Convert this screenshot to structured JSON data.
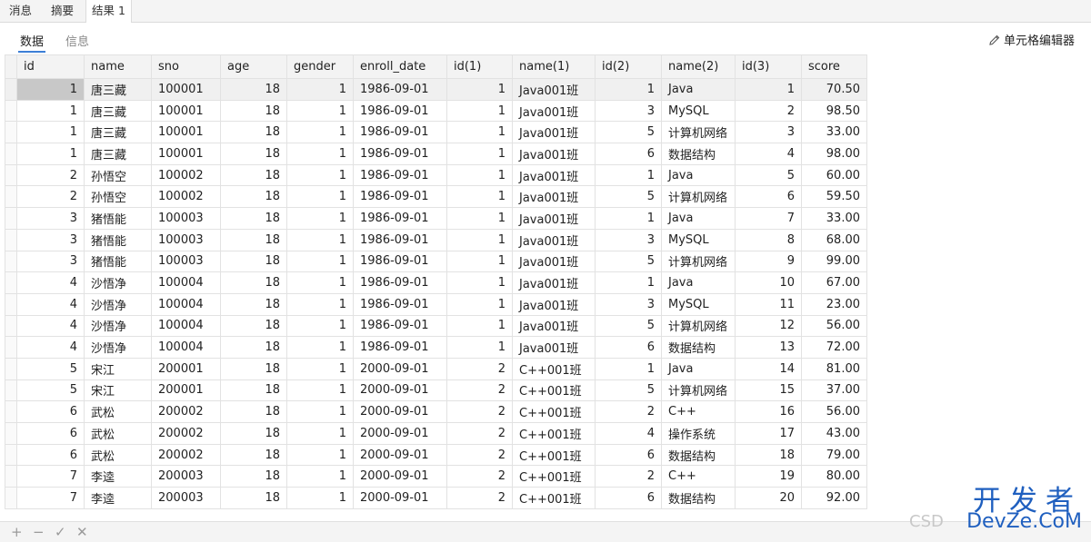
{
  "tabs": [
    "消息",
    "摘要",
    "结果 1"
  ],
  "subtabs": [
    "数据",
    "信息"
  ],
  "cell_editor_label": "单元格编辑器",
  "columns": [
    "id",
    "name",
    "sno",
    "age",
    "gender",
    "enroll_date",
    "id(1)",
    "name(1)",
    "id(2)",
    "name(2)",
    "id(3)",
    "score"
  ],
  "rows": [
    [
      "1",
      "唐三藏",
      "100001",
      "18",
      "1",
      "1986-09-01",
      "1",
      "Java001班",
      "1",
      "Java",
      "1",
      "70.50"
    ],
    [
      "1",
      "唐三藏",
      "100001",
      "18",
      "1",
      "1986-09-01",
      "1",
      "Java001班",
      "3",
      "MySQL",
      "2",
      "98.50"
    ],
    [
      "1",
      "唐三藏",
      "100001",
      "18",
      "1",
      "1986-09-01",
      "1",
      "Java001班",
      "5",
      "计算机网络",
      "3",
      "33.00"
    ],
    [
      "1",
      "唐三藏",
      "100001",
      "18",
      "1",
      "1986-09-01",
      "1",
      "Java001班",
      "6",
      "数据结构",
      "4",
      "98.00"
    ],
    [
      "2",
      "孙悟空",
      "100002",
      "18",
      "1",
      "1986-09-01",
      "1",
      "Java001班",
      "1",
      "Java",
      "5",
      "60.00"
    ],
    [
      "2",
      "孙悟空",
      "100002",
      "18",
      "1",
      "1986-09-01",
      "1",
      "Java001班",
      "5",
      "计算机网络",
      "6",
      "59.50"
    ],
    [
      "3",
      "猪悟能",
      "100003",
      "18",
      "1",
      "1986-09-01",
      "1",
      "Java001班",
      "1",
      "Java",
      "7",
      "33.00"
    ],
    [
      "3",
      "猪悟能",
      "100003",
      "18",
      "1",
      "1986-09-01",
      "1",
      "Java001班",
      "3",
      "MySQL",
      "8",
      "68.00"
    ],
    [
      "3",
      "猪悟能",
      "100003",
      "18",
      "1",
      "1986-09-01",
      "1",
      "Java001班",
      "5",
      "计算机网络",
      "9",
      "99.00"
    ],
    [
      "4",
      "沙悟净",
      "100004",
      "18",
      "1",
      "1986-09-01",
      "1",
      "Java001班",
      "1",
      "Java",
      "10",
      "67.00"
    ],
    [
      "4",
      "沙悟净",
      "100004",
      "18",
      "1",
      "1986-09-01",
      "1",
      "Java001班",
      "3",
      "MySQL",
      "11",
      "23.00"
    ],
    [
      "4",
      "沙悟净",
      "100004",
      "18",
      "1",
      "1986-09-01",
      "1",
      "Java001班",
      "5",
      "计算机网络",
      "12",
      "56.00"
    ],
    [
      "4",
      "沙悟净",
      "100004",
      "18",
      "1",
      "1986-09-01",
      "1",
      "Java001班",
      "6",
      "数据结构",
      "13",
      "72.00"
    ],
    [
      "5",
      "宋江",
      "200001",
      "18",
      "1",
      "2000-09-01",
      "2",
      "C++001班",
      "1",
      "Java",
      "14",
      "81.00"
    ],
    [
      "5",
      "宋江",
      "200001",
      "18",
      "1",
      "2000-09-01",
      "2",
      "C++001班",
      "5",
      "计算机网络",
      "15",
      "37.00"
    ],
    [
      "6",
      "武松",
      "200002",
      "18",
      "1",
      "2000-09-01",
      "2",
      "C++001班",
      "2",
      "C++",
      "16",
      "56.00"
    ],
    [
      "6",
      "武松",
      "200002",
      "18",
      "1",
      "2000-09-01",
      "2",
      "C++001班",
      "4",
      "操作系统",
      "17",
      "43.00"
    ],
    [
      "6",
      "武松",
      "200002",
      "18",
      "1",
      "2000-09-01",
      "2",
      "C++001班",
      "6",
      "数据结构",
      "18",
      "79.00"
    ],
    [
      "7",
      "李逵",
      "200003",
      "18",
      "1",
      "2000-09-01",
      "2",
      "C++001班",
      "2",
      "C++",
      "19",
      "80.00"
    ],
    [
      "7",
      "李逵",
      "200003",
      "18",
      "1",
      "2000-09-01",
      "2",
      "C++001班",
      "6",
      "数据结构",
      "20",
      "92.00"
    ]
  ],
  "bottom_buttons": [
    "+",
    "−",
    "✓",
    "✕"
  ],
  "watermark": {
    "top": "开发者",
    "bottom": "DevZe.CoM",
    "faint": "CSD"
  },
  "colors": {
    "accent": "#3c7fd6",
    "watermark": "#1f5fbf"
  }
}
